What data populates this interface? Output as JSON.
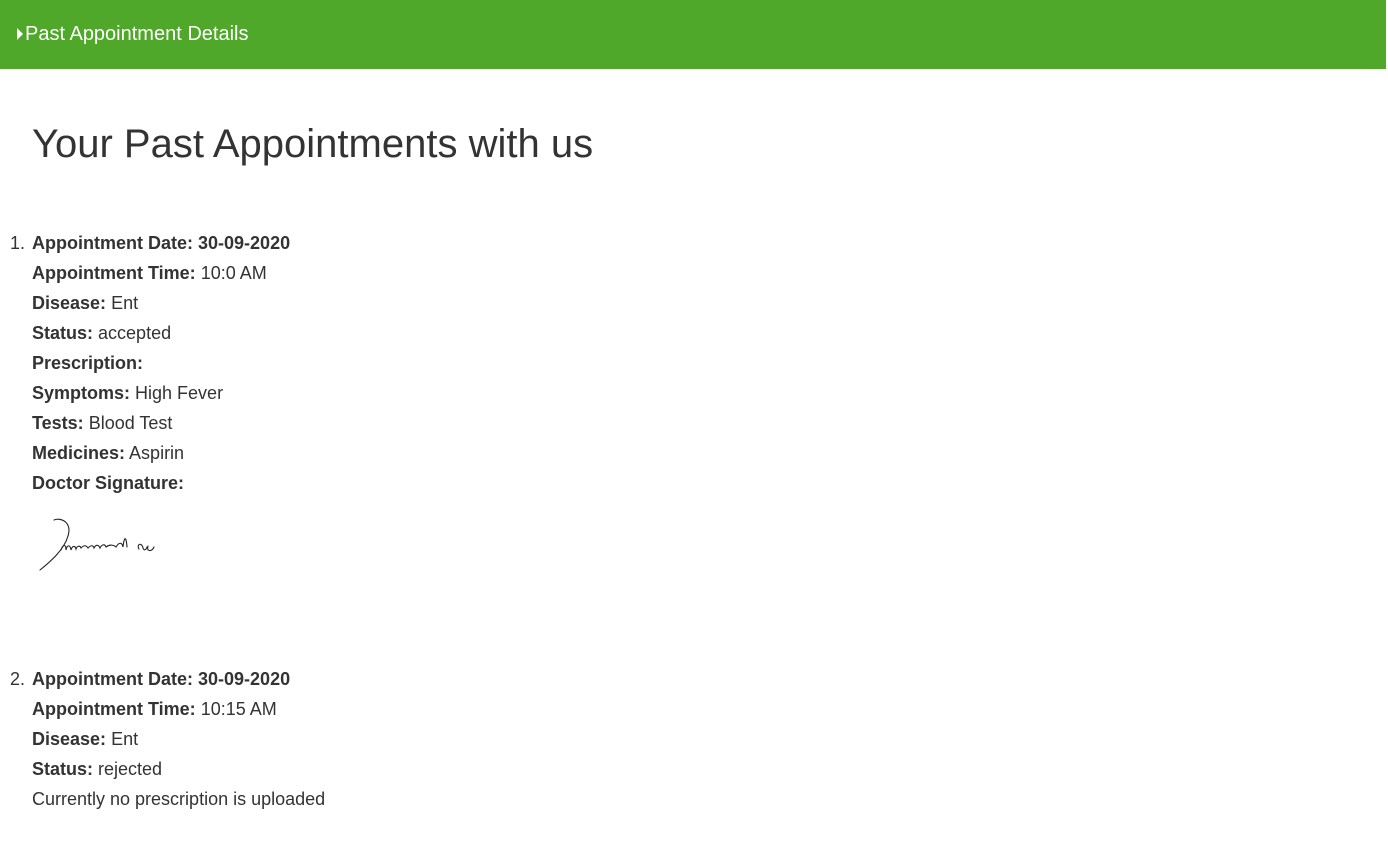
{
  "header": {
    "toggle_label": "Past Appointment Details"
  },
  "page": {
    "title": "Your Past Appointments with us"
  },
  "labels": {
    "date": "Appointment Date:",
    "time": "Appointment Time:",
    "disease": "Disease:",
    "status": "Status:",
    "prescription": "Prescription:",
    "symptoms": "Symptoms:",
    "tests": "Tests:",
    "medicines": "Medicines:",
    "signature": "Doctor Signature:"
  },
  "appointments": [
    {
      "number": "1.",
      "date": "30-09-2020",
      "time": "10:0 AM",
      "disease": "Ent",
      "status": "accepted",
      "symptoms": "High Fever",
      "tests": "Blood Test",
      "medicines": "Aspirin",
      "signature_text": "Muhamad ali"
    },
    {
      "number": "2.",
      "date": "30-09-2020",
      "time": "10:15 AM",
      "disease": "Ent",
      "status": "rejected",
      "no_prescription_text": "Currently no prescription is uploaded"
    }
  ]
}
